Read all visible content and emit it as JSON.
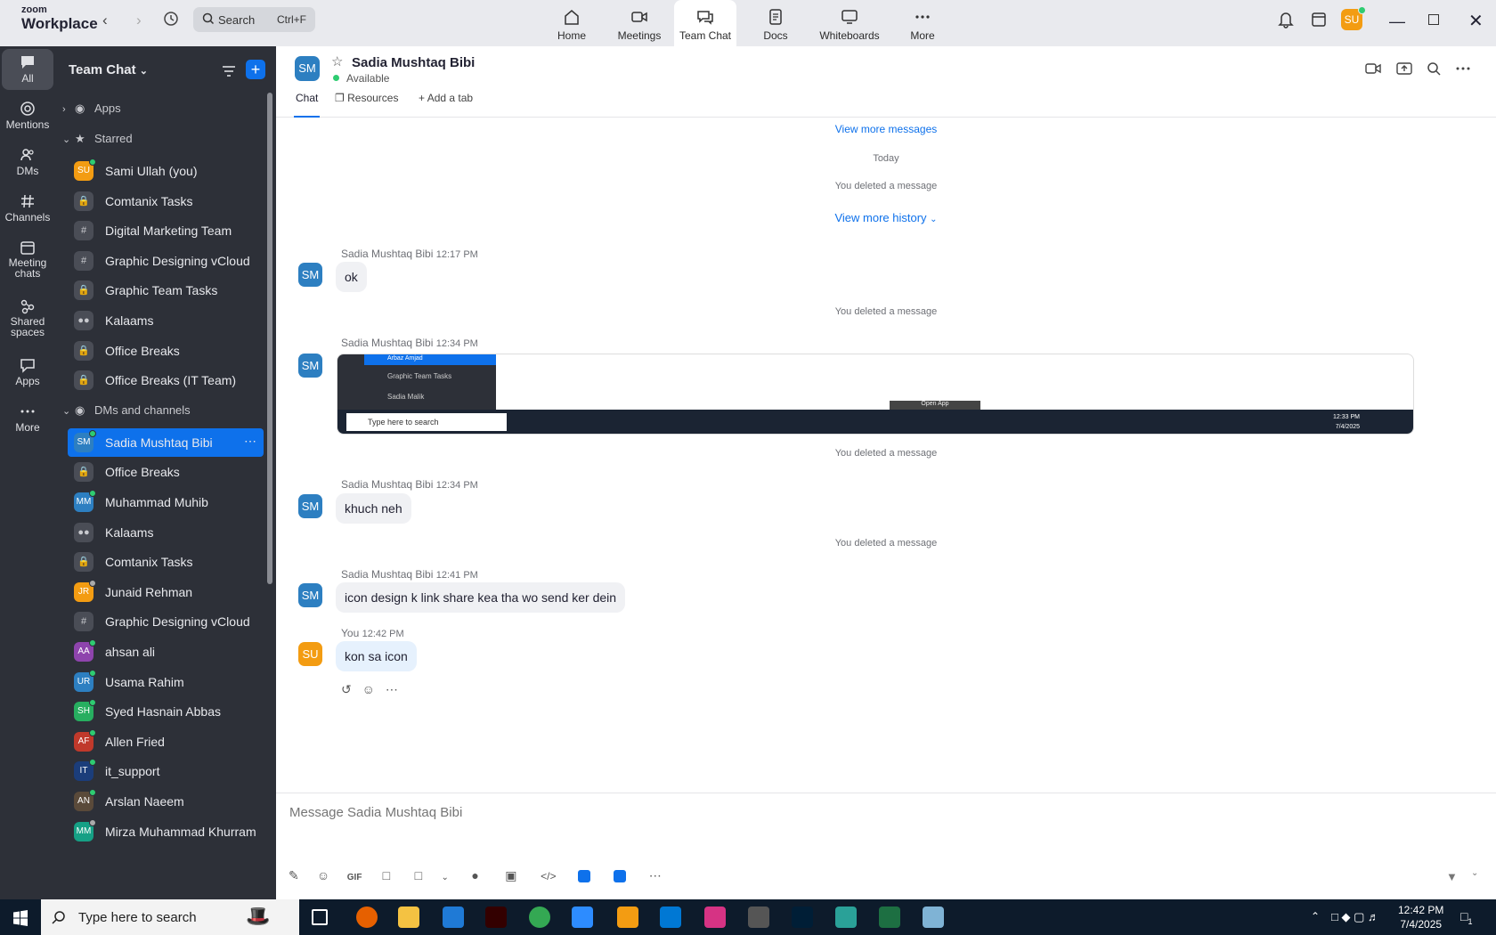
{
  "app": {
    "brand_top": "zoom",
    "brand_bottom": "Workplace"
  },
  "search": {
    "label": "Search",
    "shortcut": "Ctrl+F"
  },
  "topnav": [
    {
      "label": "Home",
      "icon": "home-icon"
    },
    {
      "label": "Meetings",
      "icon": "video-icon"
    },
    {
      "label": "Team Chat",
      "icon": "chat-icon"
    },
    {
      "label": "Docs",
      "icon": "doc-icon"
    },
    {
      "label": "Whiteboards",
      "icon": "whiteboard-icon"
    },
    {
      "label": "More",
      "icon": "more-icon"
    }
  ],
  "user": {
    "initials": "SU"
  },
  "rail": [
    {
      "label": "All"
    },
    {
      "label": "Mentions"
    },
    {
      "label": "DMs"
    },
    {
      "label": "Channels"
    },
    {
      "label": "Meeting chats"
    },
    {
      "label": "Shared spaces"
    },
    {
      "label": "Apps"
    },
    {
      "label": "More"
    }
  ],
  "panel": {
    "title": "Team Chat",
    "groups": {
      "apps": "Apps",
      "starred": "Starred",
      "dms": "DMs and channels"
    },
    "starred": [
      {
        "name": "Sami Ullah (you)",
        "initials": "SU",
        "color": "#f39c12",
        "kind": "avatar",
        "status": "#2ecc71"
      },
      {
        "name": "Comtanix Tasks",
        "kind": "lock"
      },
      {
        "name": "Digital Marketing Team",
        "kind": "hash"
      },
      {
        "name": "Graphic Designing vCloud",
        "kind": "hash"
      },
      {
        "name": "Graphic Team Tasks",
        "kind": "lock"
      },
      {
        "name": "Kalaams",
        "kind": "people"
      },
      {
        "name": "Office Breaks",
        "kind": "lock"
      },
      {
        "name": "Office Breaks (IT Team)",
        "kind": "lock"
      }
    ],
    "dms": [
      {
        "name": "Sadia Mushtaq Bibi",
        "initials": "SM",
        "color": "#2d7fc1",
        "kind": "avatar",
        "status": "#2ecc71"
      },
      {
        "name": "Office Breaks",
        "kind": "lock"
      },
      {
        "name": "Muhammad Muhib",
        "initials": "MM",
        "color": "#2d7fc1",
        "kind": "avatar",
        "status": "#2ecc71"
      },
      {
        "name": "Kalaams",
        "kind": "people"
      },
      {
        "name": "Comtanix Tasks",
        "kind": "lock"
      },
      {
        "name": "Junaid Rehman",
        "initials": "JR",
        "color": "#f39c12",
        "kind": "avatar",
        "status": "#aaaaaa"
      },
      {
        "name": "Graphic Designing vCloud",
        "kind": "hash"
      },
      {
        "name": "ahsan ali",
        "initials": "AA",
        "color": "#8e44ad",
        "kind": "avatar",
        "status": "#2ecc71"
      },
      {
        "name": "Usama Rahim",
        "initials": "UR",
        "color": "#2d7fc1",
        "kind": "avatar",
        "status": "#2ecc71"
      },
      {
        "name": "Syed Hasnain Abbas",
        "initials": "SH",
        "color": "#27ae60",
        "kind": "avatar",
        "status": "#2ecc71"
      },
      {
        "name": "Allen Fried",
        "initials": "AF",
        "color": "#c0392b",
        "kind": "avatar",
        "status": "#2ecc71"
      },
      {
        "name": "it_support",
        "initials": "IT",
        "color": "#1b3d7a",
        "kind": "avatar",
        "status": "#2ecc71"
      },
      {
        "name": "Arslan Naeem",
        "initials": "AN",
        "color": "#5a4a3a",
        "kind": "avatar",
        "status": "#2ecc71"
      },
      {
        "name": "Mirza Muhammad Khurram",
        "initials": "MM",
        "color": "#16a085",
        "kind": "avatar",
        "status": "#aaaaaa"
      }
    ]
  },
  "chat": {
    "contact": "Sadia Mushtaq Bibi",
    "initials": "SM",
    "status": "Available",
    "tabs": {
      "chat": "Chat",
      "resources": "Resources",
      "add": "Add a tab"
    },
    "view_more_messages": "View more messages",
    "today": "Today",
    "deleted": "You deleted a message",
    "view_more_history": "View more history",
    "messages": [
      {
        "sender": "Sadia Mushtaq Bibi",
        "time": "12:17 PM",
        "text": "ok"
      },
      {
        "sender": "Sadia Mushtaq Bibi",
        "time": "12:34 PM",
        "text": ""
      },
      {
        "sender": "Sadia Mushtaq Bibi",
        "time": "12:34 PM",
        "text": "khuch neh"
      },
      {
        "sender": "Sadia Mushtaq Bibi",
        "time": "12:41 PM",
        "text": "icon design k link share kea tha wo send ker dein"
      },
      {
        "sender": "You",
        "time": "12:42 PM",
        "text": "kon sa icon"
      }
    ],
    "screenshot": {
      "rows": [
        "Arbaz Amjad",
        "Graphic Team Tasks",
        "Sadia Malik"
      ],
      "search": "Type here to search",
      "open_app": "Open App",
      "time": "12:33 PM",
      "date": "7/4/2025"
    },
    "composer_placeholder": "Message Sadia Mushtaq Bibi",
    "gif": "GIF"
  },
  "taskbar": {
    "search": "Type here to search",
    "time": "12:42 PM",
    "date": "7/4/2025",
    "notif": "1"
  }
}
